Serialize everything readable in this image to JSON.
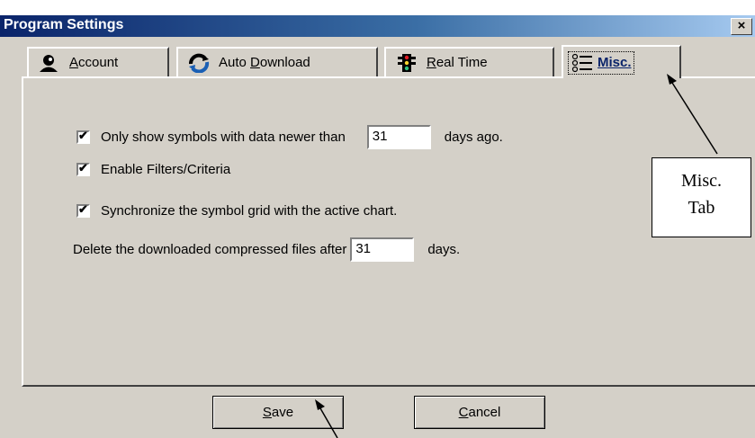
{
  "window": {
    "title": "Program Settings",
    "close_glyph": "×"
  },
  "tabs": [
    {
      "label_prefix": "",
      "label_ul": "A",
      "label_rest": "ccount",
      "icon": "account-icon",
      "active": false
    },
    {
      "label_prefix": "Auto ",
      "label_ul": "D",
      "label_rest": "ownload",
      "icon": "auto-download-icon",
      "active": false
    },
    {
      "label_prefix": "",
      "label_ul": "R",
      "label_rest": "eal Time",
      "icon": "traffic-light-icon",
      "active": false
    },
    {
      "label_prefix": "",
      "label_ul": "Misc.",
      "label_rest": "",
      "icon": "misc-list-icon",
      "active": true
    }
  ],
  "options": {
    "newer_data": {
      "label": "Only show symbols with data newer than",
      "value": "31",
      "suffix": "days ago.",
      "checked": true
    },
    "filters": {
      "label": "Enable Filters/Criteria",
      "checked": true
    },
    "sync_grid": {
      "label": "Synchronize the symbol grid with the active chart.",
      "checked": true
    },
    "delete_files": {
      "label": "Delete the downloaded compressed files after",
      "value": "31",
      "suffix": "days."
    }
  },
  "buttons": {
    "save": "Save",
    "cancel": "Cancel"
  },
  "annotation": {
    "line1": "Misc.",
    "line2": "Tab"
  }
}
